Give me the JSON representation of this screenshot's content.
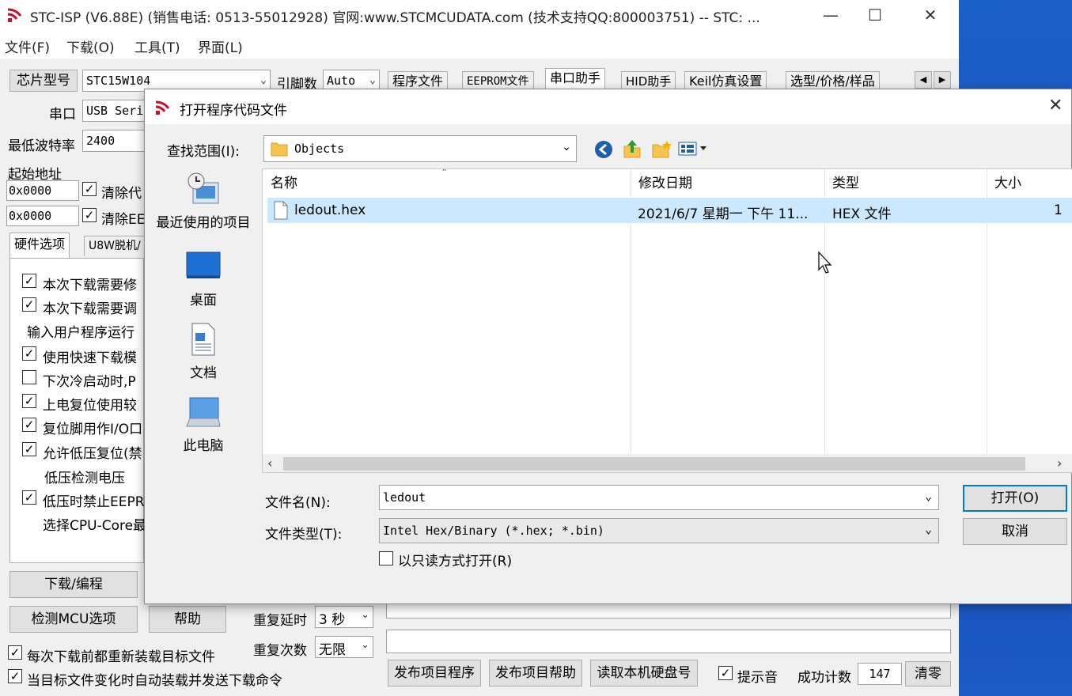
{
  "app": {
    "title": "STC-ISP (V6.88E) (销售电话: 0513-55012928) 官网:www.STCMCUDATA.com  (技术支持QQ:800003751) -- STC: ...",
    "menu": [
      "文件(F)",
      "下载(O)",
      "工具(T)",
      "界面(L)"
    ]
  },
  "left": {
    "chip_label": "芯片型号",
    "chip_value": "STC15W104",
    "pins_label": "引脚数",
    "pins_value": "Auto",
    "port_label": "串口",
    "port_value": "USB Seri",
    "baud_label": "最低波特率",
    "baud_value": "2400",
    "start_addr_label": "起始地址",
    "addr1": "0x0000",
    "clear1": "清除代",
    "addr2": "0x0000",
    "clear2": "清除EE",
    "tab_hw": "硬件选项",
    "tab_u8w": "U8W脱机/",
    "options": [
      {
        "text": "本次下载需要修",
        "checked": true
      },
      {
        "text": "本次下载需要调",
        "checked": true
      },
      {
        "text": "输入用户程序运行",
        "checked": null
      },
      {
        "text": "使用快速下载模",
        "checked": true
      },
      {
        "text": "下次冷启动时,P",
        "checked": false
      },
      {
        "text": "上电复位使用较",
        "checked": true
      },
      {
        "text": "复位脚用作I/O口",
        "checked": true
      },
      {
        "text": "允许低压复位(禁",
        "checked": true
      },
      {
        "text": "低压检测电压",
        "checked": null
      },
      {
        "text": "低压时禁止EEPR",
        "checked": true
      },
      {
        "text": "选择CPU-Core最",
        "checked": null
      }
    ],
    "download_btn": "下载/编程",
    "detect_btn": "检测MCU选项",
    "help_btn": "帮助",
    "repeat_delay_label": "重复延时",
    "repeat_delay_value": "3 秒",
    "repeat_count_label": "重复次数",
    "repeat_count_value": "无限",
    "reload_label": "每次下载前都重新装载目标文件",
    "auto_label": "当目标文件变化时自动装载并发送下载命令"
  },
  "right_tabs": [
    "程序文件",
    "EEPROM文件",
    "串口助手",
    "HID助手",
    "Keil仿真设置",
    "选型/价格/样品"
  ],
  "bottom": {
    "publish_prog": "发布项目程序",
    "publish_help": "发布项目帮助",
    "read_disk": "读取本机硬盘号",
    "sound_label": "提示音",
    "success_label": "成功计数",
    "success_count": "147",
    "clear_btn": "清零"
  },
  "dialog": {
    "title": "打开程序代码文件",
    "lookin_label": "查找范围(I):",
    "lookin_value": "Objects",
    "places": [
      "最近使用的项目",
      "桌面",
      "文档",
      "此电脑"
    ],
    "columns": [
      "名称",
      "修改日期",
      "类型",
      "大小"
    ],
    "files": [
      {
        "name": "ledout.hex",
        "date": "2021/6/7 星期一 下午 11...",
        "type": "HEX 文件",
        "size": "1"
      }
    ],
    "filename_label": "文件名(N):",
    "filename_value": "ledout",
    "filetype_label": "文件类型(T):",
    "filetype_value": "Intel Hex/Binary (*.hex; *.bin)",
    "readonly_label": "以只读方式打开(R)",
    "open_btn": "打开(O)",
    "cancel_btn": "取消"
  }
}
